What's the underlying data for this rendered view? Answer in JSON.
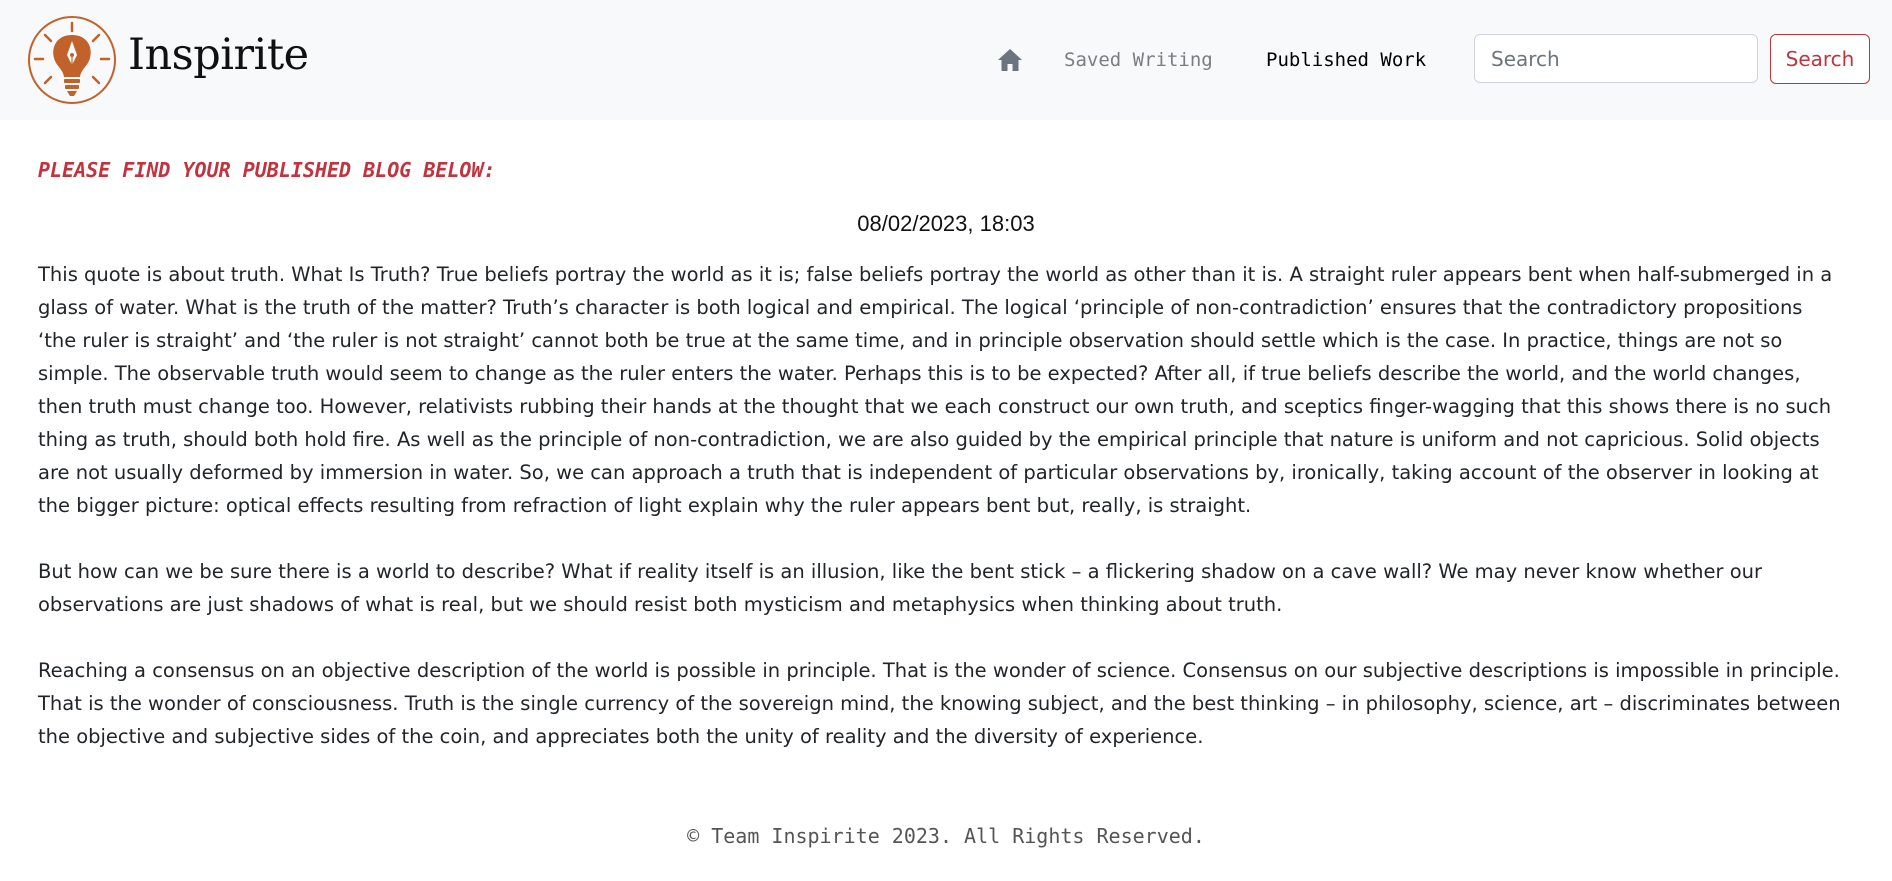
{
  "app": {
    "brand_name": "Inspirite",
    "logo_icon": "lightbulb-pen-logo",
    "accent_color": "#c0343f",
    "logo_color": "#c0622a"
  },
  "nav": {
    "home_icon": "home-icon",
    "saved_label": "Saved Writing",
    "published_label": "Published Work"
  },
  "search": {
    "placeholder": "Search",
    "value": "",
    "button_label": "Search"
  },
  "main": {
    "heading": "PLEASE FIND YOUR PUBLISHED BLOG BELOW:",
    "date": "08/02/2023, 18:03",
    "paragraphs": [
      "This quote is about truth. What Is Truth? True beliefs portray the world as it is; false beliefs portray the world as other than it is. A straight ruler appears bent when half-submerged in a glass of water. What is the truth of the matter? Truth’s character is both logical and empirical. The logical ‘principle of non-contradiction’ ensures that the contradictory propositions ‘the ruler is straight’ and ‘the ruler is not straight’ cannot both be true at the same time, and in principle observation should settle which is the case. In practice, things are not so simple. The observable truth would seem to change as the ruler enters the water. Perhaps this is to be expected? After all, if true beliefs describe the world, and the world changes, then truth must change too. However, relativists rubbing their hands at the thought that we each construct our own truth, and sceptics finger-wagging that this shows there is no such thing as truth, should both hold fire. As well as the principle of non-contradiction, we are also guided by the empirical principle that nature is uniform and not capricious. Solid objects are not usually deformed by immersion in water. So, we can approach a truth that is independent of particular observations by, ironically, taking account of the observer in looking at the bigger picture: optical effects resulting from refraction of light explain why the ruler appears bent but, really, is straight.",
      "But how can we be sure there is a world to describe? What if reality itself is an illusion, like the bent stick – a flickering shadow on a cave wall? We may never know whether our observations are just shadows of what is real, but we should resist both mysticism and metaphysics when thinking about truth.",
      "Reaching a consensus on an objective description of the world is possible in principle. That is the wonder of science. Consensus on our subjective descriptions is impossible in principle. That is the wonder of consciousness. Truth is the single currency of the sovereign mind, the knowing subject, and the best thinking – in philosophy, science, art – discriminates between the objective and subjective sides of the coin, and appreciates both the unity of reality and the diversity of experience."
    ]
  },
  "footer": {
    "text": "© Team Inspirite 2023. All Rights Reserved."
  }
}
